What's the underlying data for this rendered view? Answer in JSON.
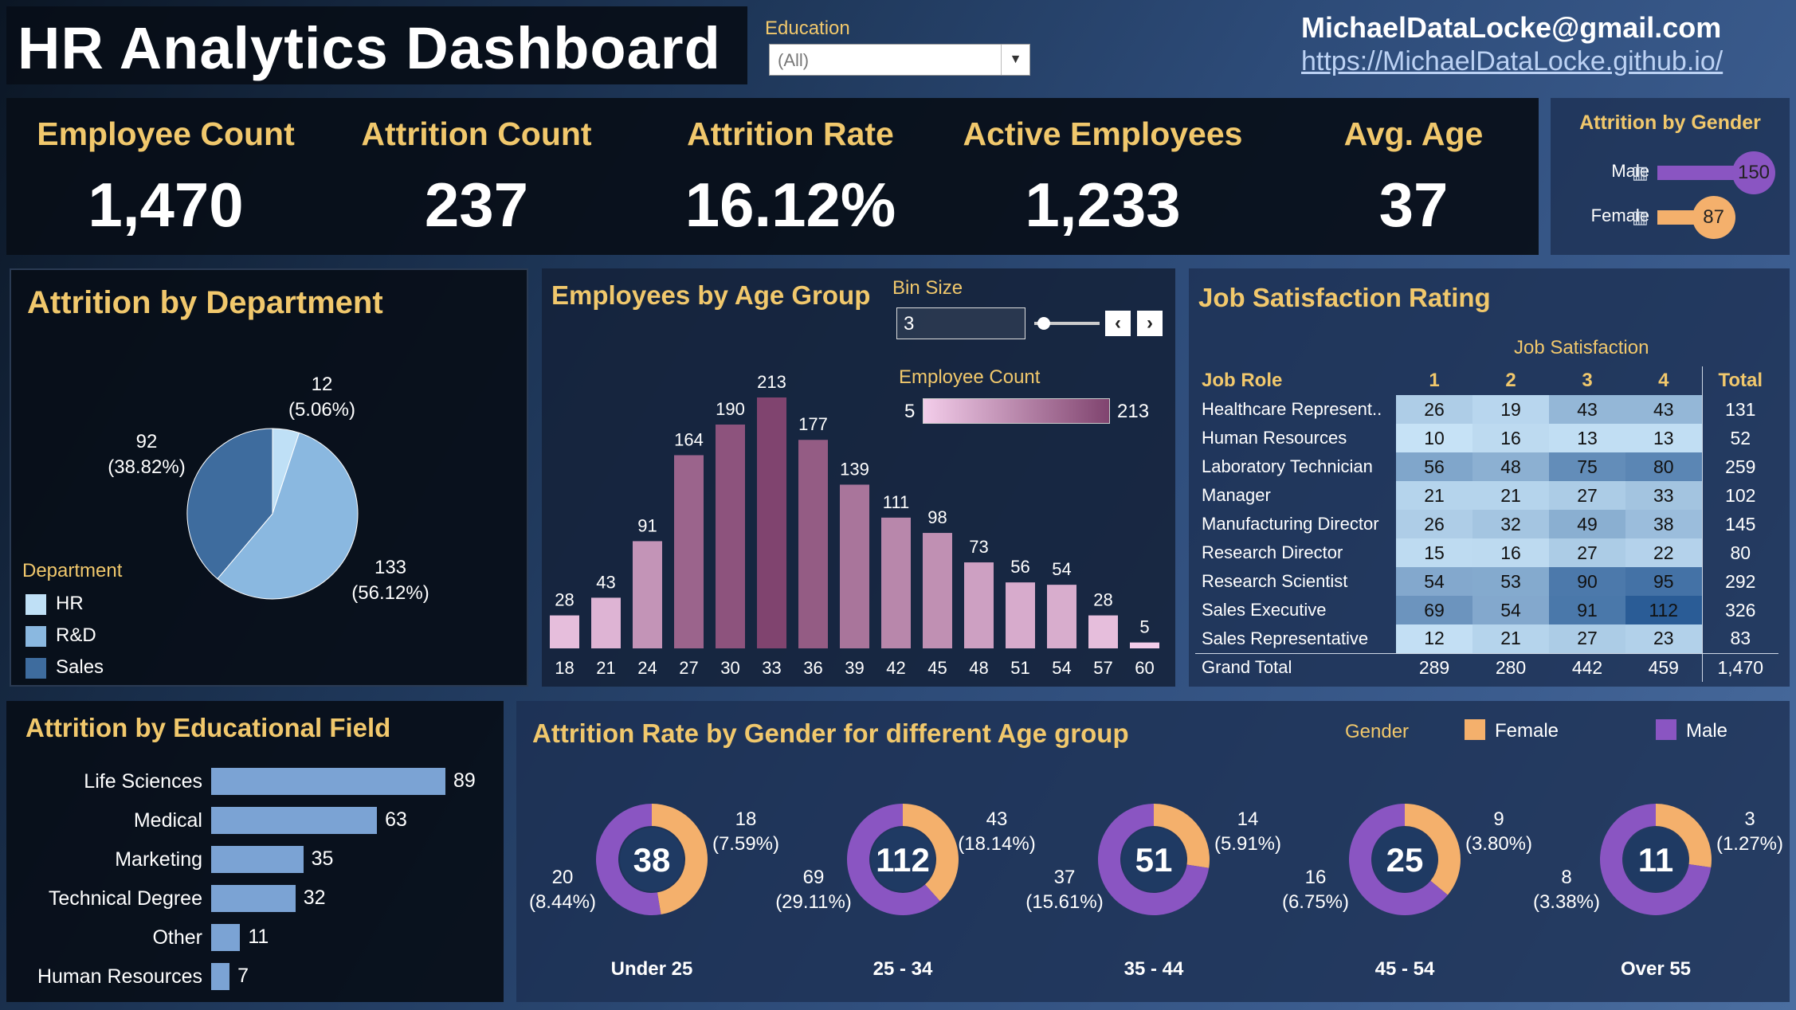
{
  "header": {
    "title": "HR Analytics Dashboard",
    "education_label": "Education",
    "education_value": "(All)",
    "email": "MichaelDataLocke@gmail.com",
    "url": "https://MichaelDataLocke.github.io/"
  },
  "kpis": [
    {
      "label": "Employee Count",
      "value": "1,470"
    },
    {
      "label": "Attrition Count",
      "value": "237"
    },
    {
      "label": "Attrition Rate",
      "value": "16.12%"
    },
    {
      "label": "Active Employees",
      "value": "1,233"
    },
    {
      "label": "Avg. Age",
      "value": "37"
    }
  ],
  "gender_attrition": {
    "title": "Attrition by Gender",
    "rows": [
      {
        "label": "Male",
        "value": 150,
        "color": "#8a55c2"
      },
      {
        "label": "Female",
        "value": 87,
        "color": "#f4b06c"
      }
    ]
  },
  "department": {
    "title": "Attrition by Department",
    "legend_title": "Department",
    "slices": [
      {
        "name": "HR",
        "value": 12,
        "label": "12",
        "pct": "(5.06%)",
        "color": "#bfe0f6"
      },
      {
        "name": "R&D",
        "value": 133,
        "label": "133",
        "pct": "(56.12%)",
        "color": "#8ab8e0"
      },
      {
        "name": "Sales",
        "value": 92,
        "label": "92",
        "pct": "(38.82%)",
        "color": "#3e6c9e"
      }
    ]
  },
  "age_group": {
    "title": "Employees by Age Group",
    "bin_size_label": "Bin Size",
    "bin_size": "3",
    "color_legend_title": "Employee Count",
    "color_min": "5",
    "color_max": "213",
    "bars": [
      {
        "age": "18",
        "count": 28
      },
      {
        "age": "21",
        "count": 43
      },
      {
        "age": "24",
        "count": 91
      },
      {
        "age": "27",
        "count": 164
      },
      {
        "age": "30",
        "count": 190
      },
      {
        "age": "33",
        "count": 213
      },
      {
        "age": "36",
        "count": 177
      },
      {
        "age": "39",
        "count": 139
      },
      {
        "age": "42",
        "count": 111
      },
      {
        "age": "45",
        "count": 98
      },
      {
        "age": "48",
        "count": 73
      },
      {
        "age": "51",
        "count": 56
      },
      {
        "age": "54",
        "count": 54
      },
      {
        "age": "57",
        "count": 28
      },
      {
        "age": "60",
        "count": 5
      }
    ]
  },
  "job_satisfaction": {
    "title": "Job Satisfaction Rating",
    "header_group": "Job Satisfaction",
    "col_role": "Job Role",
    "cols": [
      "1",
      "2",
      "3",
      "4"
    ],
    "col_total": "Total",
    "rows": [
      {
        "role": "Healthcare Represent..",
        "v": [
          26,
          19,
          43,
          43
        ],
        "total": "131"
      },
      {
        "role": "Human Resources",
        "v": [
          10,
          16,
          13,
          13
        ],
        "total": "52"
      },
      {
        "role": "Laboratory Technician",
        "v": [
          56,
          48,
          75,
          80
        ],
        "total": "259"
      },
      {
        "role": "Manager",
        "v": [
          21,
          21,
          27,
          33
        ],
        "total": "102"
      },
      {
        "role": "Manufacturing Director",
        "v": [
          26,
          32,
          49,
          38
        ],
        "total": "145"
      },
      {
        "role": "Research Director",
        "v": [
          15,
          16,
          27,
          22
        ],
        "total": "80"
      },
      {
        "role": "Research Scientist",
        "v": [
          54,
          53,
          90,
          95
        ],
        "total": "292"
      },
      {
        "role": "Sales Executive",
        "v": [
          69,
          54,
          91,
          112
        ],
        "total": "326"
      },
      {
        "role": "Sales Representative",
        "v": [
          12,
          21,
          27,
          23
        ],
        "total": "83"
      }
    ],
    "grand_total_label": "Grand Total",
    "grand_totals": [
      "289",
      "280",
      "442",
      "459"
    ],
    "grand_total": "1,470"
  },
  "edu_field": {
    "title": "Attrition by Educational Field",
    "bars": [
      {
        "label": "Life Sciences",
        "value": 89
      },
      {
        "label": "Medical",
        "value": 63
      },
      {
        "label": "Marketing",
        "value": 35
      },
      {
        "label": "Technical Degree",
        "value": 32
      },
      {
        "label": "Other",
        "value": 11
      },
      {
        "label": "Human Resources",
        "value": 7
      }
    ]
  },
  "gender_age": {
    "title": "Attrition Rate by Gender for different Age group",
    "legend_title": "Gender",
    "legend": [
      {
        "name": "Female",
        "color": "#f4b06c"
      },
      {
        "name": "Male",
        "color": "#8a55c2"
      }
    ],
    "groups": [
      {
        "group": "Under 25",
        "total": "38",
        "female": 18,
        "female_pct": "(7.59%)",
        "male": 20,
        "male_pct": "(8.44%)"
      },
      {
        "group": "25 - 34",
        "total": "112",
        "female": 43,
        "female_pct": "(18.14%)",
        "male": 69,
        "male_pct": "(29.11%)"
      },
      {
        "group": "35 - 44",
        "total": "51",
        "female": 14,
        "female_pct": "(5.91%)",
        "male": 37,
        "male_pct": "(15.61%)"
      },
      {
        "group": "45 - 54",
        "total": "25",
        "female": 9,
        "female_pct": "(3.80%)",
        "male": 16,
        "male_pct": "(6.75%)"
      },
      {
        "group": "Over 55",
        "total": "11",
        "female": 3,
        "female_pct": "(1.27%)",
        "male": 8,
        "male_pct": "(3.38%)"
      }
    ]
  }
}
